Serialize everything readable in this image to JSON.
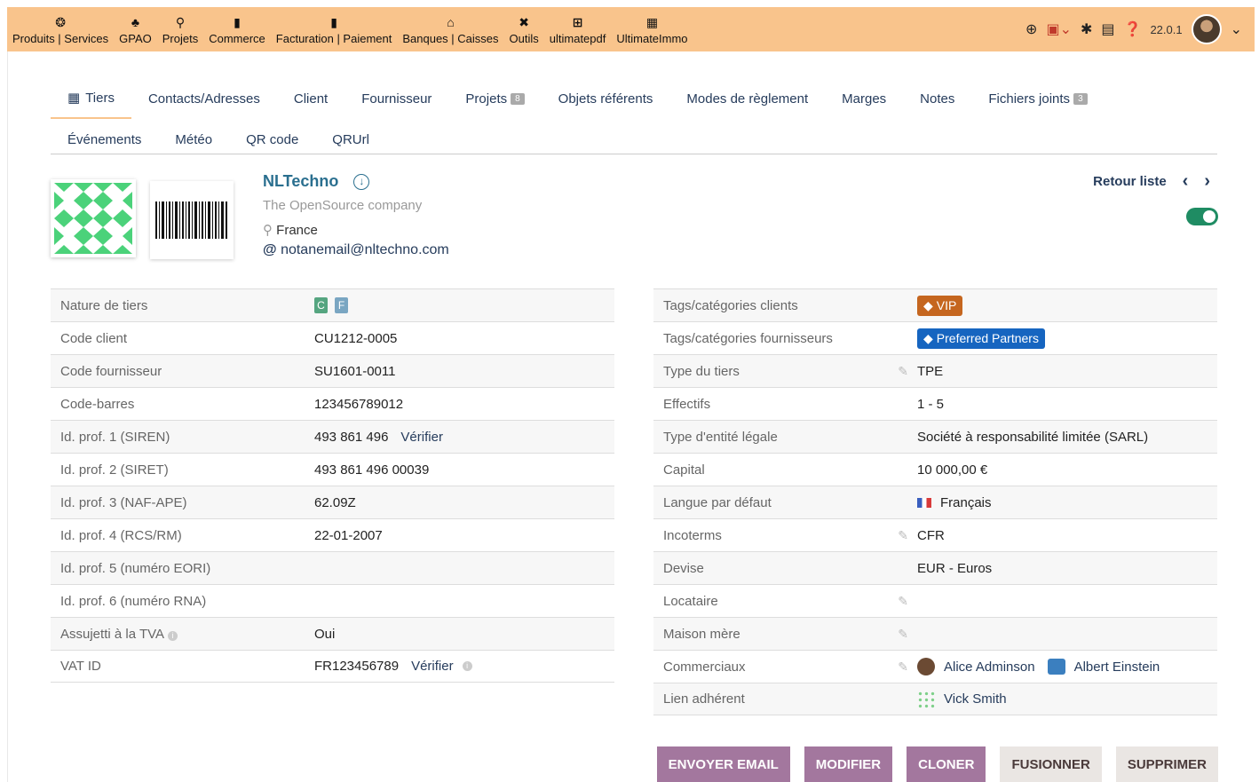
{
  "topmenu": {
    "items": [
      {
        "label": "Produits | Services",
        "icon": "cube-icon",
        "glyph": "❂"
      },
      {
        "label": "GPAO",
        "icon": "cubes-icon",
        "glyph": "♣"
      },
      {
        "label": "Projets",
        "icon": "sitemap-icon",
        "glyph": "⚲"
      },
      {
        "label": "Commerce",
        "icon": "briefcase-icon",
        "glyph": "▮"
      },
      {
        "label": "Facturation | Paiement",
        "icon": "invoice-icon",
        "glyph": "▮"
      },
      {
        "label": "Banques | Caisses",
        "icon": "bank-icon",
        "glyph": "⌂"
      },
      {
        "label": "Outils",
        "icon": "tools-icon",
        "glyph": "✖"
      },
      {
        "label": "ultimatepdf",
        "icon": "plus-square-icon",
        "glyph": "⊞"
      },
      {
        "label": "UltimateImmo",
        "icon": "building-icon",
        "glyph": "▦"
      }
    ],
    "version": "22.0.1"
  },
  "tabs": {
    "row1": [
      {
        "label": "Tiers",
        "badge": ""
      },
      {
        "label": "Contacts/Adresses",
        "badge": ""
      },
      {
        "label": "Client",
        "badge": ""
      },
      {
        "label": "Fournisseur",
        "badge": ""
      },
      {
        "label": "Projets",
        "badge": "8"
      },
      {
        "label": "Objets référents",
        "badge": ""
      },
      {
        "label": "Modes de règlement",
        "badge": ""
      },
      {
        "label": "Marges",
        "badge": ""
      },
      {
        "label": "Notes",
        "badge": ""
      },
      {
        "label": "Fichiers joints",
        "badge": "3"
      }
    ],
    "row2": [
      {
        "label": "Événements"
      },
      {
        "label": "Météo"
      },
      {
        "label": "QR code"
      },
      {
        "label": "QRUrl"
      }
    ]
  },
  "company": {
    "name": "NLTechno",
    "subtitle": "The OpenSource company",
    "country": "France",
    "email": "notanemail@nltechno.com"
  },
  "nav": {
    "back_list": "Retour liste",
    "prev": "‹",
    "next": "›"
  },
  "left_fields": [
    {
      "label": "Nature de tiers",
      "value": "",
      "tags": [
        "C",
        "F"
      ]
    },
    {
      "label": "Code client",
      "value": "CU1212-0005"
    },
    {
      "label": "Code fournisseur",
      "value": "SU1601-0011"
    },
    {
      "label": "Code-barres",
      "value": "123456789012"
    },
    {
      "label": "Id. prof. 1 (SIREN)",
      "value": "493 861 496",
      "link": "Vérifier"
    },
    {
      "label": "Id. prof. 2 (SIRET)",
      "value": "493 861 496 00039"
    },
    {
      "label": "Id. prof. 3 (NAF-APE)",
      "value": "62.09Z"
    },
    {
      "label": "Id. prof. 4 (RCS/RM)",
      "value": "22-01-2007"
    },
    {
      "label": "Id. prof. 5 (numéro EORI)",
      "value": ""
    },
    {
      "label": "Id. prof. 6 (numéro RNA)",
      "value": ""
    },
    {
      "label": "Assujetti à la TVA",
      "value": "Oui",
      "info": true
    },
    {
      "label": "VAT ID",
      "value": "FR123456789",
      "link": "Vérifier",
      "linkinfo": true
    }
  ],
  "right_fields": [
    {
      "label": "Tags/catégories clients",
      "tag": "VIP",
      "tagclass": "vip"
    },
    {
      "label": "Tags/catégories fournisseurs",
      "tag": "Preferred Partners",
      "tagclass": "pp"
    },
    {
      "label": "Type du tiers",
      "value": "TPE",
      "edit": true
    },
    {
      "label": "Effectifs",
      "value": "1 - 5"
    },
    {
      "label": "Type d'entité légale",
      "value": "Société à responsabilité limitée (SARL)"
    },
    {
      "label": "Capital",
      "value": "10 000,00 €"
    },
    {
      "label": "Langue par défaut",
      "value": "Français",
      "flag": true
    },
    {
      "label": "Incoterms",
      "value": "CFR",
      "edit": true
    },
    {
      "label": "Devise",
      "value": "EUR - Euros"
    },
    {
      "label": "Locataire",
      "value": "",
      "edit": true
    },
    {
      "label": "Maison mère",
      "value": "",
      "edit": true
    },
    {
      "label": "Commerciaux",
      "value": "",
      "edit": true,
      "users": [
        "Alice Adminson",
        "Albert Einstein"
      ]
    },
    {
      "label": "Lien adhérent",
      "value": "",
      "member": "Vick Smith"
    }
  ],
  "actions": {
    "send_email": "ENVOYER EMAIL",
    "modify": "MODIFIER",
    "clone": "CLONER",
    "merge": "FUSIONNER",
    "delete": "SUPPRIMER"
  },
  "colors": {
    "topbar": "#f9c48c",
    "primary_button": "#a3779e",
    "link": "#263c5c",
    "accent_green": "#1f8c63"
  }
}
